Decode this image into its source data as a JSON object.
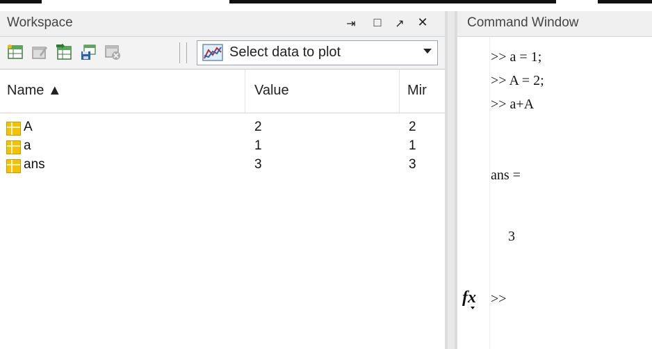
{
  "workspace": {
    "title": "Workspace",
    "controls": {
      "undock": "⇥",
      "maximize": "□",
      "popout": "↗",
      "close": "✕"
    },
    "toolbar": {
      "icons": [
        "new-variable-icon",
        "edit-variable-icon",
        "import-data-icon",
        "save-workspace-icon",
        "delete-icon"
      ],
      "plot_select_label": "Select data to plot"
    },
    "columns": [
      "Name ▲",
      "Value",
      "Mir"
    ],
    "variables": [
      {
        "name": "A",
        "value": "2",
        "min": "2"
      },
      {
        "name": "a",
        "value": "1",
        "min": "1"
      },
      {
        "name": "ans",
        "value": "3",
        "min": "3"
      }
    ]
  },
  "command_window": {
    "title": "Command Window",
    "lines": [
      ">> a = 1;",
      ">> A = 2;",
      ">> a+A",
      "",
      "ans =",
      "",
      "     3",
      ""
    ],
    "prompt": ">>",
    "fx_label": "fx"
  }
}
